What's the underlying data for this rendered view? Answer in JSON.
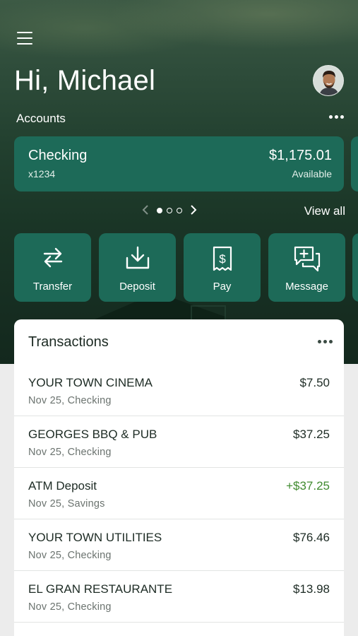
{
  "header": {
    "greeting": "Hi, Michael",
    "menu_icon": "hamburger-menu-icon",
    "avatar": "user-avatar"
  },
  "accounts": {
    "label": "Accounts",
    "more_icon": "more-horizontal-icon",
    "card": {
      "name": "Checking",
      "number": "x1234",
      "balance": "$1,175.01",
      "balance_label": "Available"
    },
    "pager": {
      "current_page": 1,
      "total_pages": 3
    },
    "view_all": "View all"
  },
  "quick_actions": [
    {
      "label": "Transfer",
      "icon": "transfer-icon"
    },
    {
      "label": "Deposit",
      "icon": "deposit-icon"
    },
    {
      "label": "Pay",
      "icon": "pay-bill-icon"
    },
    {
      "label": "Message",
      "icon": "message-icon"
    }
  ],
  "transactions": {
    "title": "Transactions",
    "more_icon": "more-horizontal-icon",
    "items": [
      {
        "name": "YOUR TOWN CINEMA",
        "date_account": "Nov 25, Checking",
        "amount": "$7.50",
        "type": "debit"
      },
      {
        "name": "GEORGES BBQ & PUB",
        "date_account": "Nov 25, Checking",
        "amount": "$37.25",
        "type": "debit"
      },
      {
        "name": "ATM Deposit",
        "date_account": "Nov 25, Savings",
        "amount": "+$37.25",
        "type": "credit"
      },
      {
        "name": "YOUR TOWN UTILITIES",
        "date_account": "Nov 25, Checking",
        "amount": "$76.46",
        "type": "debit"
      },
      {
        "name": "EL GRAN RESTAURANTE",
        "date_account": "Nov 25, Checking",
        "amount": "$13.98",
        "type": "debit"
      }
    ]
  },
  "colors": {
    "primary": "#1d6a58",
    "hero_dark": "#162d21",
    "credit": "#3f8a2e",
    "text": "#1d2b24",
    "muted": "#6b736f"
  }
}
